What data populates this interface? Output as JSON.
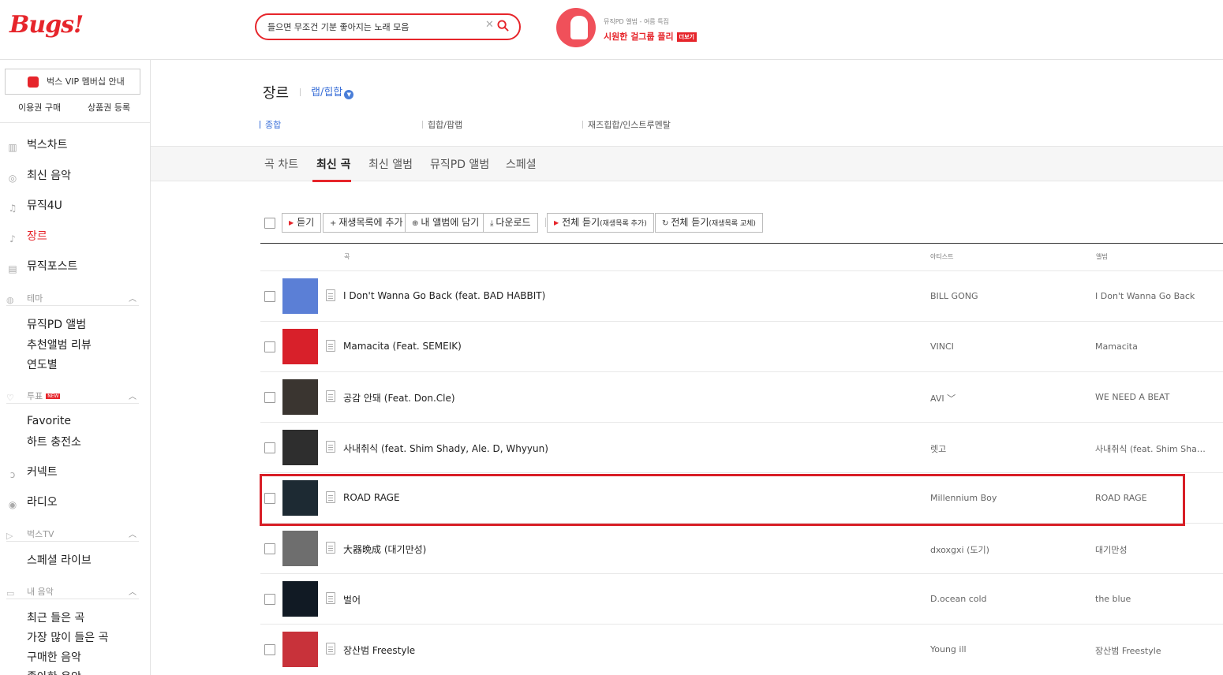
{
  "header": {
    "logo": "Bugs!",
    "search": {
      "value": "들으면 무조건 기분 좋아지는 노래 모음",
      "clear": "✕"
    },
    "promo": {
      "subtitle": "뮤직PD 앨범 - 여름 특집",
      "title": "시원한 걸그룹 플리",
      "more": "더보기"
    }
  },
  "sidebar": {
    "vip_label": "벅스 VIP 멤버십 안내",
    "ticket_buy": "이용권 구매",
    "coupon": "상품권 등록",
    "nav": [
      {
        "label": "벅스차트",
        "icon": "chart-icon"
      },
      {
        "label": "최신 음악",
        "icon": "new-music-icon"
      },
      {
        "label": "뮤직4U",
        "icon": "music-note-icon"
      },
      {
        "label": "장르",
        "icon": "genre-icon"
      },
      {
        "label": "뮤직포스트",
        "icon": "music-post-icon"
      }
    ],
    "theme": {
      "label": "테마",
      "items": [
        "뮤직PD 앨범",
        "추천앨범 리뷰",
        "연도별"
      ]
    },
    "vote": {
      "label": "투표",
      "badge": "NEW",
      "items": [
        "Favorite",
        "하트 충전소"
      ]
    },
    "connect": "커넥트",
    "radio": "라디오",
    "bugstv": {
      "label": "벅스TV",
      "items": [
        "스페셜 라이브"
      ]
    },
    "mymusic": {
      "label": "내 음악",
      "items": [
        "최근 들은 곡",
        "가장 많이 들은 곡",
        "구매한 음악",
        "좋아한 음악"
      ]
    }
  },
  "main": {
    "genre_title": "장르",
    "genre_selected": "랩/힙합",
    "subgenres": [
      "종합",
      "힙합/팝랩",
      "재즈힙합/인스트루멘탈"
    ],
    "tabs": [
      "곡 차트",
      "최신 곡",
      "최신 앨범",
      "뮤직PD 앨범",
      "스페셜"
    ],
    "toolbar": {
      "listen": "듣기",
      "add_playlist": "재생목록에 추가",
      "add_album": "내 앨범에 담기",
      "download": "다운로드",
      "play_all_add": "전체 듣기",
      "play_all_add_sub": "(재생목록 추가)",
      "play_all_replace": "전체 듣기",
      "play_all_replace_sub": "(재생목록 교체)"
    },
    "columns": {
      "song": "곡",
      "artist": "아티스트",
      "album": "앨범"
    },
    "tracks": [
      {
        "title": "I Don't Wanna Go Back (feat. BAD HABBIT)",
        "artist": "BILL GONG",
        "album": "I Don't Wanna Go Back",
        "cover": "#5b7fd6"
      },
      {
        "title": "Mamacita (Feat. SEMEIK)",
        "artist": "VINCI",
        "album": "Mamacita",
        "cover": "#d8202a"
      },
      {
        "title": "공감 안돼 (Feat. Don.Cle)",
        "artist": "AVI ﹀",
        "album": "WE NEED A BEAT",
        "cover": "#3a3530"
      },
      {
        "title": "사내취식 (feat. Shim Shady, Ale. D, Whyyun)",
        "artist": "렛고",
        "album": "사내취식 (feat. Shim Shady, Ale. D, Whyyun)",
        "cover": "#2e2e2e"
      },
      {
        "title": "ROAD RAGE",
        "artist": "Millennium Boy",
        "album": "ROAD RAGE",
        "cover": "#1d2a33"
      },
      {
        "title": "大器晩成 (대기만성)",
        "artist": "dxoxgxi (도기)",
        "album": "대기만성",
        "cover": "#6e6e6e"
      },
      {
        "title": "벌어",
        "artist": "D.ocean cold",
        "album": "the blue",
        "cover": "#111a24"
      },
      {
        "title": "장산범 Freestyle",
        "artist": "Young ill",
        "album": "장산범 Freestyle",
        "cover": "#c8323a"
      }
    ]
  }
}
